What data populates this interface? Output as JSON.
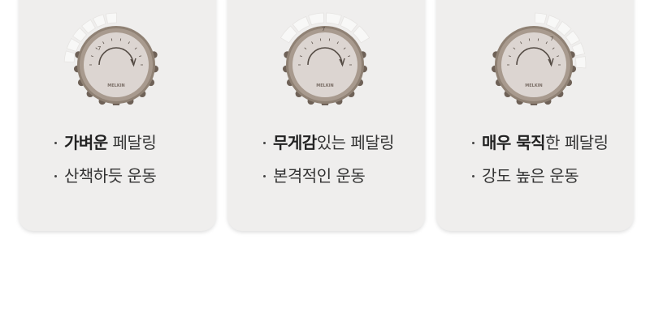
{
  "colors": {
    "card_bg": "#efeeed",
    "dial_body": "#8f8174",
    "dial_face": "#dcd5d1",
    "scale_segments": "#f7f7f6",
    "text": "#333333"
  },
  "dial_brand": "MELKIN",
  "dial_max_mark": "7",
  "cards": [
    {
      "level": "light",
      "line1_bold": "가벼운",
      "line1_rest": " 페달링",
      "line2": "산책하듯 운동"
    },
    {
      "level": "medium",
      "line1_bold": "무게감",
      "line1_rest": "있는 페달링",
      "line2": "본격적인 운동"
    },
    {
      "level": "heavy",
      "line1_bold": "매우 묵직",
      "line1_rest": "한 페달링",
      "line2": "강도 높은 운동"
    }
  ]
}
